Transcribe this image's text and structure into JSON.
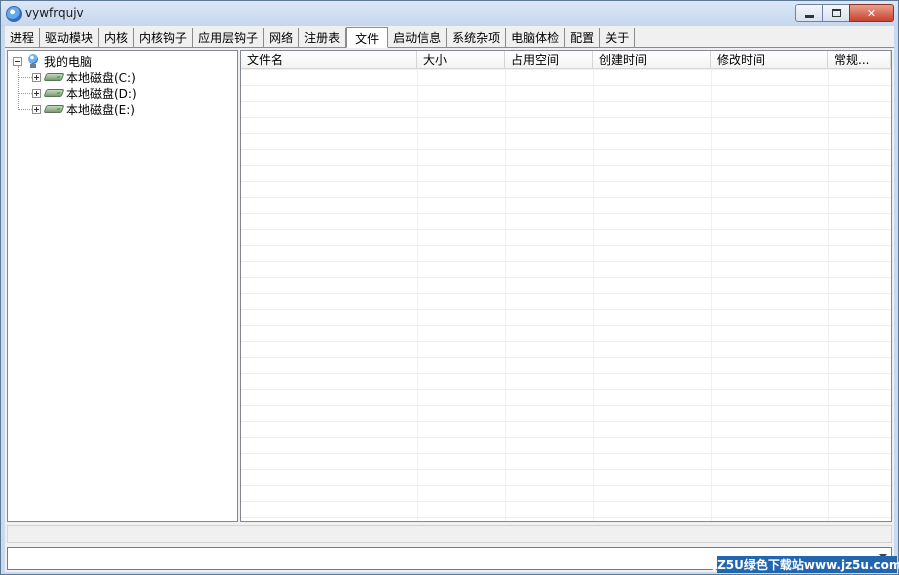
{
  "window": {
    "title": "vywfrqujv"
  },
  "tabs": [
    {
      "label": "进程"
    },
    {
      "label": "驱动模块"
    },
    {
      "label": "内核"
    },
    {
      "label": "内核钩子"
    },
    {
      "label": "应用层钩子"
    },
    {
      "label": "网络"
    },
    {
      "label": "注册表"
    },
    {
      "label": "文件",
      "active": true
    },
    {
      "label": "启动信息"
    },
    {
      "label": "系统杂项"
    },
    {
      "label": "电脑体检"
    },
    {
      "label": "配置"
    },
    {
      "label": "关于"
    }
  ],
  "tree": {
    "root": "我的电脑",
    "drives": [
      "本地磁盘(C:)",
      "本地磁盘(D:)",
      "本地磁盘(E:)"
    ]
  },
  "list": {
    "columns": [
      "文件名",
      "大小",
      "占用空间",
      "创建时间",
      "修改时间",
      "常规..."
    ]
  },
  "watermark": "JZ5U绿色下载站www.jz5u.com",
  "icons": {
    "app": "globe-icon",
    "root": "computer-icon",
    "drive": "hard-drive-icon",
    "combo": "chevron-down-icon"
  }
}
